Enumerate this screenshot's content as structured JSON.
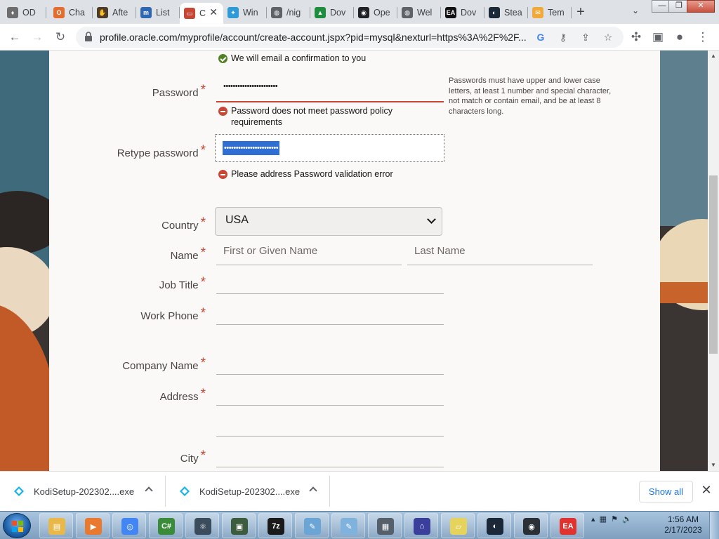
{
  "browser": {
    "tabs": [
      {
        "title": "OD",
        "color": "#6d6d6d",
        "glyph": "♦"
      },
      {
        "title": "Cha",
        "color": "#e36c2e",
        "glyph": "O"
      },
      {
        "title": "Afte",
        "color": "#4e3b2a",
        "glyph": "✋"
      },
      {
        "title": "List",
        "color": "#2f67b1",
        "glyph": "m"
      },
      {
        "title": "C",
        "color": "#c74634",
        "glyph": "▭"
      },
      {
        "title": "Win",
        "color": "#2e9bd6",
        "glyph": "✦"
      },
      {
        "title": "/nig",
        "color": "#5f6368",
        "glyph": "◍"
      },
      {
        "title": "Dov",
        "color": "#1e8e3e",
        "glyph": "▲"
      },
      {
        "title": "Ope",
        "color": "#202124",
        "glyph": "◉"
      },
      {
        "title": "Wel",
        "color": "#5f6368",
        "glyph": "◍"
      },
      {
        "title": "Dov",
        "color": "#111111",
        "glyph": "EA"
      },
      {
        "title": "Stea",
        "color": "#1b2838",
        "glyph": "◐"
      },
      {
        "title": "Tem",
        "color": "#f2a93b",
        "glyph": "✉"
      }
    ],
    "url": "profile.oracle.com/myprofile/account/create-account.jspx?pid=mysql&nexturl=https%3A%2F%2F...",
    "icons": [
      "back-icon",
      "forward-icon",
      "reload-icon",
      "lock-icon",
      "google-icon",
      "key-icon",
      "share-icon",
      "star-icon",
      "extensions-icon",
      "sidepanel-icon",
      "profile-icon",
      "menu-icon"
    ]
  },
  "form": {
    "email_confirmation": "We will email a confirmation to you",
    "password": {
      "label": "Password",
      "value": "•••••••••••••••••••••••",
      "error": "Password does not meet password policy requirements",
      "hint": "Passwords must have upper and lower case letters, at least 1 number and special character, not match or contain email, and be at least 8 characters long."
    },
    "retype_password": {
      "label": "Retype password",
      "value": "•••••••••••••••••••••••",
      "error": "Please address Password validation error"
    },
    "country": {
      "label": "Country",
      "value": "USA"
    },
    "name": {
      "label": "Name",
      "first_placeholder": "First or Given Name",
      "last_placeholder": "Last Name"
    },
    "job_title": {
      "label": "Job Title"
    },
    "work_phone": {
      "label": "Work Phone"
    },
    "company_name": {
      "label": "Company Name"
    },
    "address": {
      "label": "Address"
    },
    "city": {
      "label": "City"
    },
    "required_mark": "*"
  },
  "downloads": {
    "items": [
      {
        "name": "KodiSetup-202302....exe"
      },
      {
        "name": "KodiSetup-202302....exe"
      }
    ],
    "show_all": "Show all"
  },
  "taskbar": {
    "apps": [
      {
        "name": "windows-explorer",
        "color": "#e8b84a",
        "glyph": "▤"
      },
      {
        "name": "media-player",
        "color": "#e8792f",
        "glyph": "▶"
      },
      {
        "name": "chrome",
        "color": "#4285f4",
        "glyph": "◎"
      },
      {
        "name": "csharp-editor",
        "color": "#3a8c3a",
        "glyph": "C#"
      },
      {
        "name": "atom-app",
        "color": "#3b4d5c",
        "glyph": "⚛"
      },
      {
        "name": "terminal-app",
        "color": "#3d5c3d",
        "glyph": "▣"
      },
      {
        "name": "7zip",
        "color": "#1a1a1a",
        "glyph": "7z"
      },
      {
        "name": "notepad-app",
        "color": "#6aa5d6",
        "glyph": "✎"
      },
      {
        "name": "notepad-app-2",
        "color": "#7fb3de",
        "glyph": "✎"
      },
      {
        "name": "chip-app",
        "color": "#55606a",
        "glyph": "▦"
      },
      {
        "name": "arc-app",
        "color": "#3b3f9c",
        "glyph": "⌂"
      },
      {
        "name": "notes-app",
        "color": "#e5d35c",
        "glyph": "▱"
      },
      {
        "name": "steam",
        "color": "#1b2838",
        "glyph": "◐"
      },
      {
        "name": "circle-app",
        "color": "#2b2f36",
        "glyph": "◉"
      },
      {
        "name": "ea-app",
        "color": "#e0322f",
        "glyph": "EA"
      }
    ],
    "time": "1:56 AM",
    "date": "2/17/2023"
  }
}
